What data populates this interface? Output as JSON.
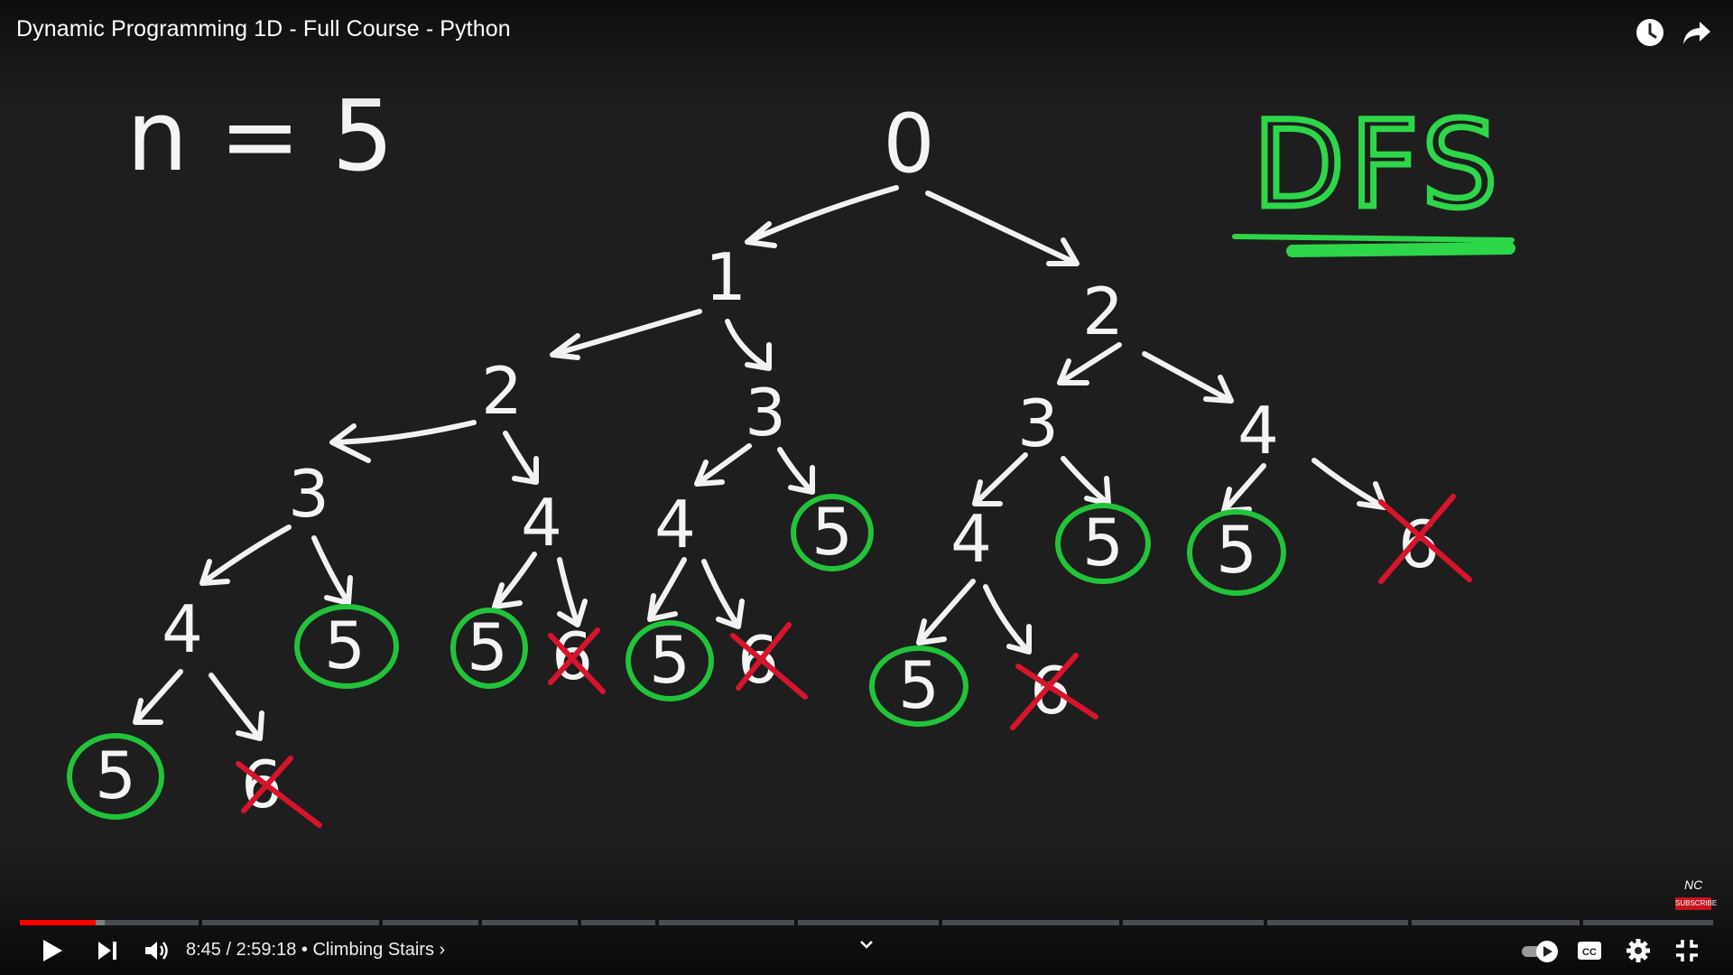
{
  "video": {
    "title": "Dynamic Programming 1D - Full Course - Python"
  },
  "board": {
    "n_label": "n = 5",
    "method_label": "DFS",
    "nodes": [
      {
        "label": "0"
      },
      {
        "label": "1"
      },
      {
        "label": "2"
      },
      {
        "label": "2"
      },
      {
        "label": "3"
      },
      {
        "label": "3"
      },
      {
        "label": "4"
      },
      {
        "label": "3"
      },
      {
        "label": "4"
      },
      {
        "label": "4"
      },
      {
        "label": "5"
      },
      {
        "label": "4"
      },
      {
        "label": "5"
      },
      {
        "label": "5"
      },
      {
        "label": "6"
      },
      {
        "label": "4"
      },
      {
        "label": "5"
      },
      {
        "label": "5"
      },
      {
        "label": "6"
      },
      {
        "label": "5"
      },
      {
        "label": "6"
      },
      {
        "label": "5"
      },
      {
        "label": "6"
      },
      {
        "label": "5"
      },
      {
        "label": "6"
      }
    ]
  },
  "player": {
    "time_current": "8:45",
    "time_total": "2:59:18",
    "separator": " / ",
    "bullet": " • ",
    "chapter": "Climbing Stairs",
    "chapter_chevron": "›",
    "progress_played": 0.045,
    "progress_buffered": 0.05,
    "watermark_text": "SUBSCRIBE",
    "watermark_logo": "NC"
  },
  "colors": {
    "accent": "#ff0000",
    "circle": "#22c33a",
    "cross": "#d8142d",
    "underline": "#2ed64a"
  },
  "icons": {
    "watch_later": "clock-icon",
    "share": "share-icon",
    "play": "play-icon",
    "next": "next-icon",
    "volume": "volume-icon",
    "chapters": "chevron-down-icon",
    "autoplay": "autoplay-toggle",
    "captions": "cc-icon",
    "settings": "gear-icon",
    "exit_fullscreen": "exit-fullscreen-icon"
  }
}
